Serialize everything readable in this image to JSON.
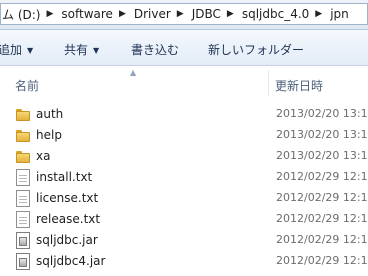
{
  "address_bar": {
    "segments": [
      "ム (D:)",
      "software",
      "Driver",
      "JDBC",
      "sqljdbc_4.0",
      "jpn"
    ]
  },
  "toolbar": {
    "add_label": "追加",
    "share_label": "共有",
    "burn_label": "書き込む",
    "new_folder_label": "新しいフォルダー"
  },
  "columns": {
    "name": "名前",
    "date_modified": "更新日時"
  },
  "files": [
    {
      "name": "auth",
      "type": "folder",
      "date": "2013/02/20 13:1"
    },
    {
      "name": "help",
      "type": "folder",
      "date": "2013/02/20 13:1"
    },
    {
      "name": "xa",
      "type": "folder",
      "date": "2013/02/20 13:1"
    },
    {
      "name": "install.txt",
      "type": "text",
      "date": "2012/02/29 12:1"
    },
    {
      "name": "license.txt",
      "type": "text",
      "date": "2012/02/29 12:1"
    },
    {
      "name": "release.txt",
      "type": "text",
      "date": "2012/02/29 12:1"
    },
    {
      "name": "sqljdbc.jar",
      "type": "jar",
      "date": "2012/02/29 12:1"
    },
    {
      "name": "sqljdbc4.jar",
      "type": "jar",
      "date": "2012/02/29 12:1"
    }
  ],
  "colors": {
    "toolbar_text": "#1e3355",
    "date_text": "#6d6d6d",
    "header_text": "#4c607a"
  }
}
